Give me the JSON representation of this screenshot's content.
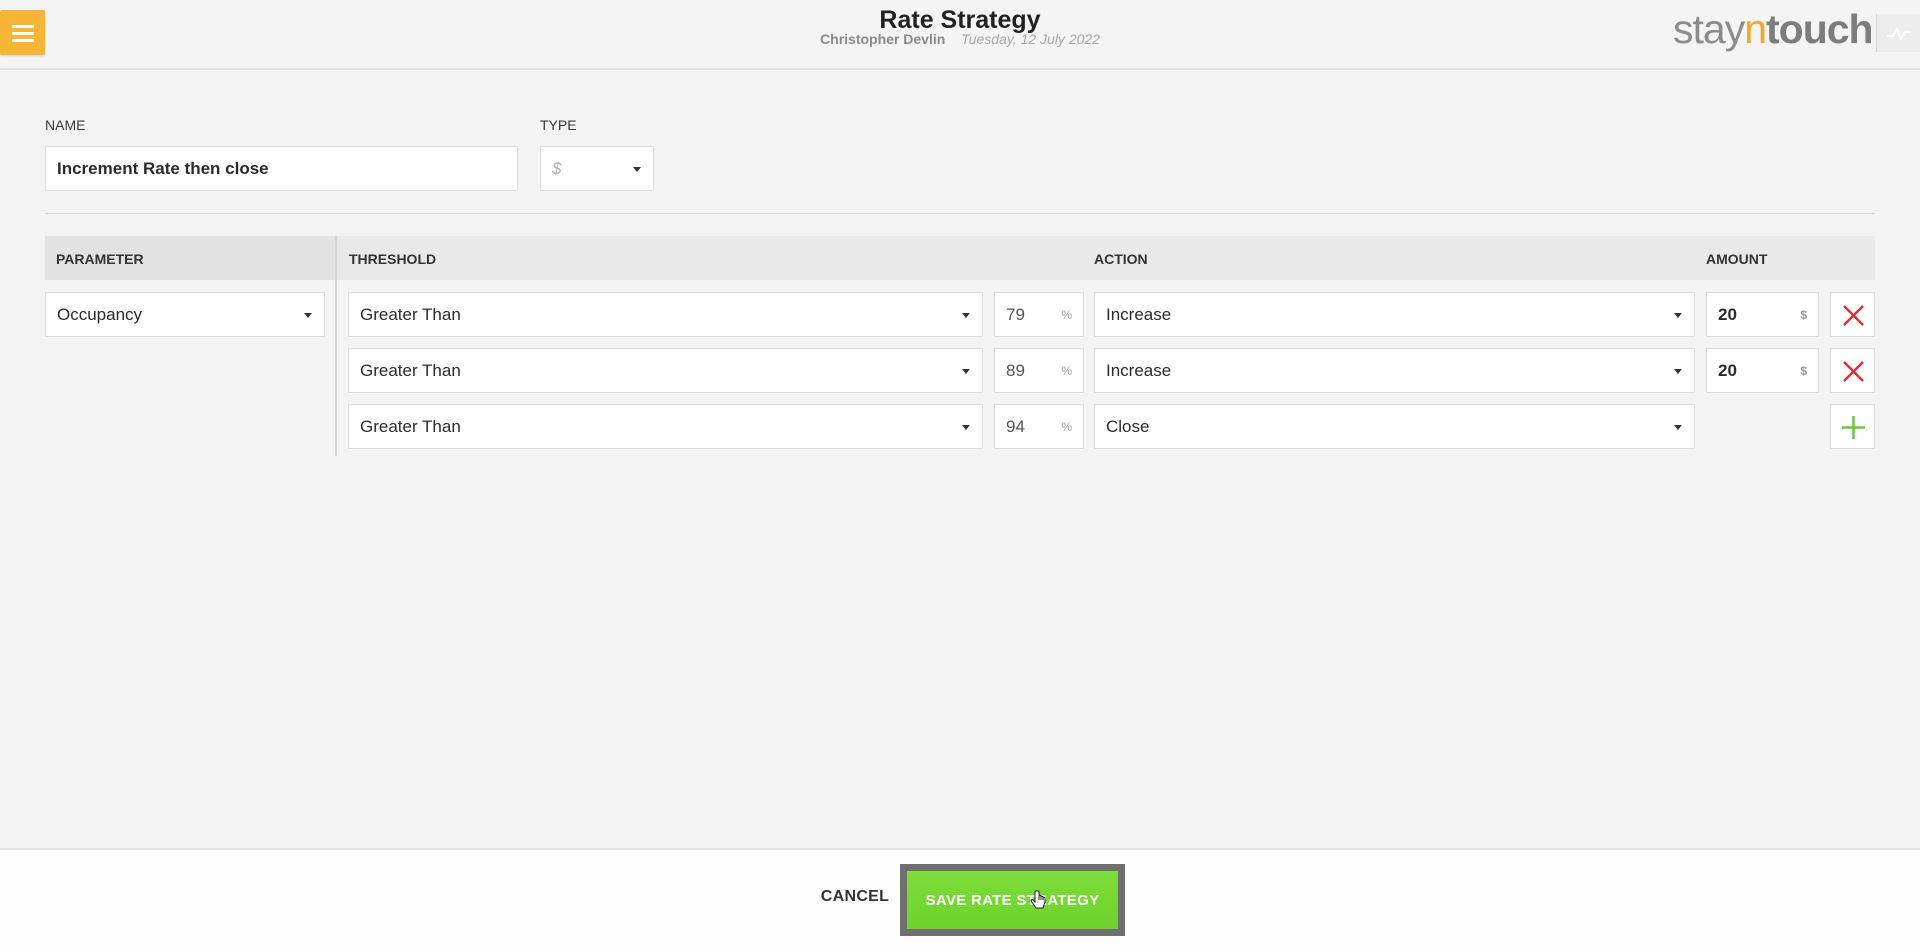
{
  "header": {
    "title": "Rate Strategy",
    "user": "Christopher Devlin",
    "date": "Tuesday, 12 July 2022",
    "logo": {
      "part1": "stay",
      "part2": "n",
      "part3": "touch"
    }
  },
  "form": {
    "name_label": "NAME",
    "name_value": "Increment Rate then close",
    "type_label": "TYPE",
    "type_value": "$"
  },
  "table": {
    "headers": {
      "parameter": "PARAMETER",
      "threshold": "THRESHOLD",
      "action": "ACTION",
      "amount": "AMOUNT"
    },
    "parameter": "Occupancy",
    "rows": [
      {
        "comparison": "Greater Than",
        "value": "79",
        "unit": "%",
        "action": "Increase",
        "amount": "20",
        "amount_unit": "$",
        "control": "remove"
      },
      {
        "comparison": "Greater Than",
        "value": "89",
        "unit": "%",
        "action": "Increase",
        "amount": "20",
        "amount_unit": "$",
        "control": "remove"
      },
      {
        "comparison": "Greater Than",
        "value": "94",
        "unit": "%",
        "action": "Close",
        "control": "add"
      }
    ]
  },
  "footer": {
    "cancel": "CANCEL",
    "save": "SAVE RATE STRATEGY"
  },
  "colors": {
    "menu": "#f6b535",
    "remove": "#d0343b",
    "add": "#6cc644",
    "save": "#72d630"
  }
}
